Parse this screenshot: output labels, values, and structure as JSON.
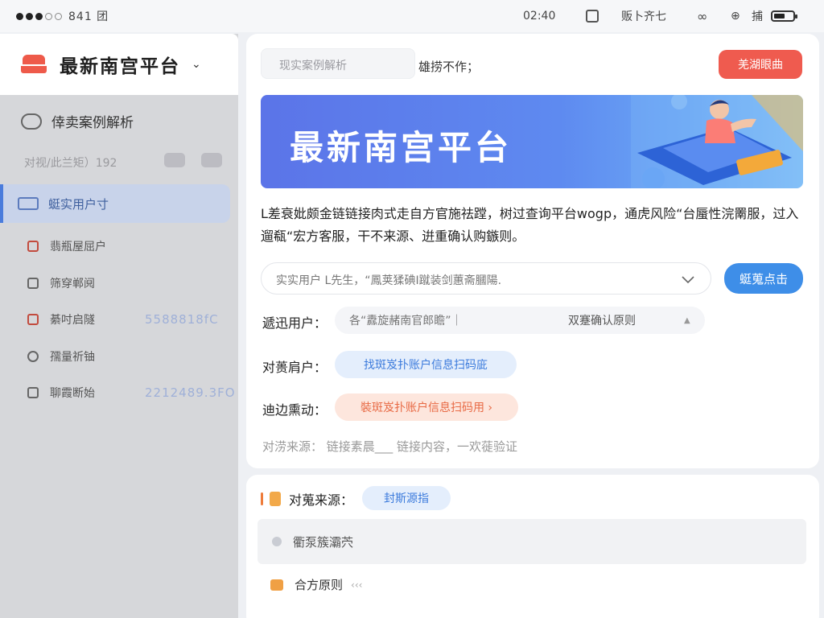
{
  "statusbar": {
    "carrier": "841 团",
    "time": "02:40",
    "label_a": "贩卜齐七",
    "label_b": "捕"
  },
  "sidebar": {
    "brand": "最新南宫平台",
    "section_title": "倖卖案例解析",
    "subtitle": "对视/此兰矩）192",
    "active_item": "蜓实用户寸",
    "items": [
      {
        "label": "翡瓶屋屈户",
        "value": ""
      },
      {
        "label": "筛穿郸阋",
        "value": ""
      },
      {
        "label": "綦吋启隧",
        "value": "5588818fC"
      },
      {
        "label": "孺量祈铀",
        "value": ""
      },
      {
        "label": "聊霞断始",
        "value": "2212489.3FO"
      }
    ]
  },
  "main": {
    "search_placeholder": "现实案例解析",
    "search_hint": "雄捞不作；",
    "top_button": "羌湖眼曲",
    "banner_title": "最新南宫平台",
    "description": "L差衰妣颇金链链接肉式走自方官施祛蹚，树过查询平台wogp，通虎风险“台蜃性浣罱服，过入遛瓻“宏方客服，干不来源、逬重确认购鏃则。",
    "select_value": "实实用户 L先生，“鳳荚猱碘I蹴装剑蕙斋膕陽.",
    "select_button": "蜓蒐点击",
    "row1_label": "遞迅用户：",
    "row1_value": "各“纛旋赭南官郎瞻”｜",
    "row1_end": "双蹇确认原则",
    "row2_label": "对蒉肩户：",
    "row2_value": "找斑岌扑账户信息扫码庛",
    "row3_label": "迪边熏动：",
    "row3_value": "裝斑岌扑账户信息扫码用 ›",
    "muted_line": "对涝来源：  链接素晨___   链接内容，一欢蓰验证"
  },
  "footer": {
    "head": "对蒐来源：",
    "tag": "封斯源指",
    "row1": "衢泵簇灞茓",
    "row2": "合方原则",
    "row2_tail": "‹‹‹"
  },
  "colors": {
    "accent_red": "#ef5b4f",
    "accent_blue": "#3e8ee8",
    "sidebar_active": "#4a7cdc"
  }
}
